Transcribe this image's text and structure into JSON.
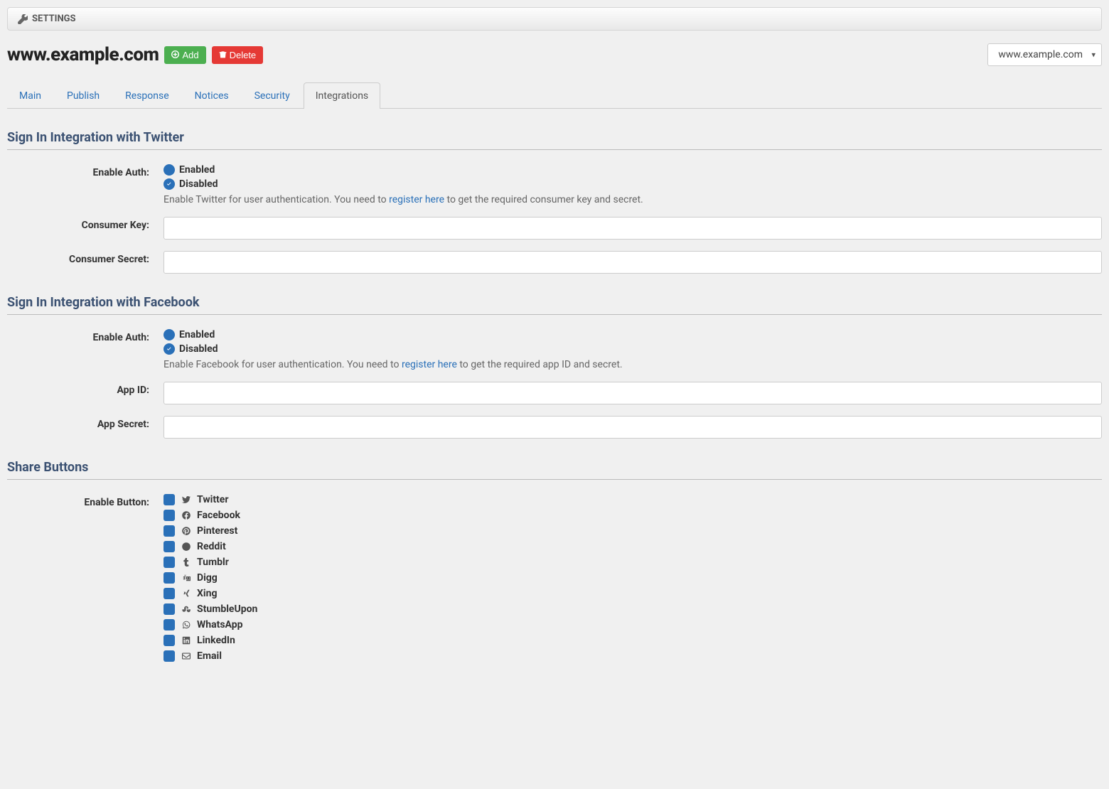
{
  "header": {
    "title": "SETTINGS"
  },
  "domain": "www.example.com",
  "buttons": {
    "add": "Add",
    "delete": "Delete"
  },
  "selector": {
    "value": "www.example.com"
  },
  "tabs": [
    {
      "label": "Main",
      "active": false
    },
    {
      "label": "Publish",
      "active": false
    },
    {
      "label": "Response",
      "active": false
    },
    {
      "label": "Notices",
      "active": false
    },
    {
      "label": "Security",
      "active": false
    },
    {
      "label": "Integrations",
      "active": true
    }
  ],
  "twitter": {
    "title": "Sign In Integration with Twitter",
    "enable_label": "Enable Auth:",
    "enabled": "Enabled",
    "disabled": "Disabled",
    "help_pre": "Enable Twitter for user authentication. You need to ",
    "help_link": "register here",
    "help_post": " to get the required consumer key and secret.",
    "key_label": "Consumer Key:",
    "secret_label": "Consumer Secret:"
  },
  "facebook": {
    "title": "Sign In Integration with Facebook",
    "enable_label": "Enable Auth:",
    "enabled": "Enabled",
    "disabled": "Disabled",
    "help_pre": "Enable Facebook for user authentication. You need to ",
    "help_link": "register here",
    "help_post": " to get the required app ID and secret.",
    "id_label": "App ID:",
    "secret_label": "App Secret:"
  },
  "share": {
    "title": "Share Buttons",
    "label": "Enable Button:",
    "items": [
      {
        "name": "Twitter"
      },
      {
        "name": "Facebook"
      },
      {
        "name": "Pinterest"
      },
      {
        "name": "Reddit"
      },
      {
        "name": "Tumblr"
      },
      {
        "name": "Digg"
      },
      {
        "name": "Xing"
      },
      {
        "name": "StumbleUpon"
      },
      {
        "name": "WhatsApp"
      },
      {
        "name": "LinkedIn"
      },
      {
        "name": "Email"
      }
    ]
  }
}
